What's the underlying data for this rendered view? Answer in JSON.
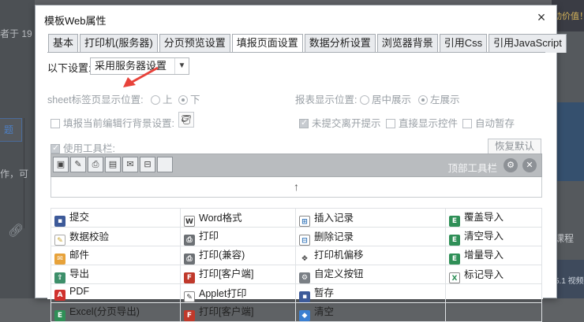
{
  "background": {
    "left_text_1": "者于 19 者",
    "left_button": "题",
    "left_text_2": "作，可",
    "right_ad_text": "动价值！",
    "right_text": "课程",
    "right_bottom_text": "5.1 视频"
  },
  "dialog": {
    "title": "模板Web属性",
    "close_label": "×"
  },
  "tabs": [
    {
      "label": "基本"
    },
    {
      "label": "打印机(服务器)"
    },
    {
      "label": "分页预览设置"
    },
    {
      "label": "填报页面设置"
    },
    {
      "label": "数据分析设置"
    },
    {
      "label": "浏览器背景"
    },
    {
      "label": "引用Css"
    },
    {
      "label": "引用JavaScript"
    }
  ],
  "settings": {
    "mode_label": "以下设置:",
    "mode_value": "采用服务器设置",
    "sheet_pos_label": "sheet标签页显示位置:",
    "sheet_pos_options": [
      "上",
      "下"
    ],
    "report_pos_label": "报表显示位置:",
    "report_pos_options": [
      "居中展示",
      "左展示"
    ],
    "fill_bg_label": "填报当前编辑行背景设置:",
    "unsubmitted_label": "未提交离开提示",
    "direct_show_label": "直接显示控件",
    "auto_save_label": "自动暂存",
    "use_toolbar_label": "使用工具栏:",
    "reset_label": "恢复默认"
  },
  "toolbar": {
    "top_label": "顶部工具栏",
    "icons": [
      "save-icon",
      "edit-icon",
      "print-icon",
      "export-icon",
      "mail-icon",
      "structure-icon",
      "blank-icon"
    ]
  },
  "items": [
    [
      "提交",
      "Word格式",
      "插入记录",
      "覆盖导入"
    ],
    [
      "数据校验",
      "打印",
      "删除记录",
      "清空导入"
    ],
    [
      "邮件",
      "打印(兼容)",
      "打印机偏移",
      "增量导入"
    ],
    [
      "导出",
      "打印[客户端]",
      "自定义按钮",
      "标记导入"
    ],
    [
      "PDF",
      "Applet打印",
      "暂存",
      ""
    ],
    [
      "Excel(分页导出)",
      "打印[客户端]",
      "清空",
      ""
    ]
  ],
  "colors": {
    "accent_arrow": "#e8423a",
    "toolbar_bg": "#b9bcbf",
    "tab_border": "#a7acb2"
  }
}
